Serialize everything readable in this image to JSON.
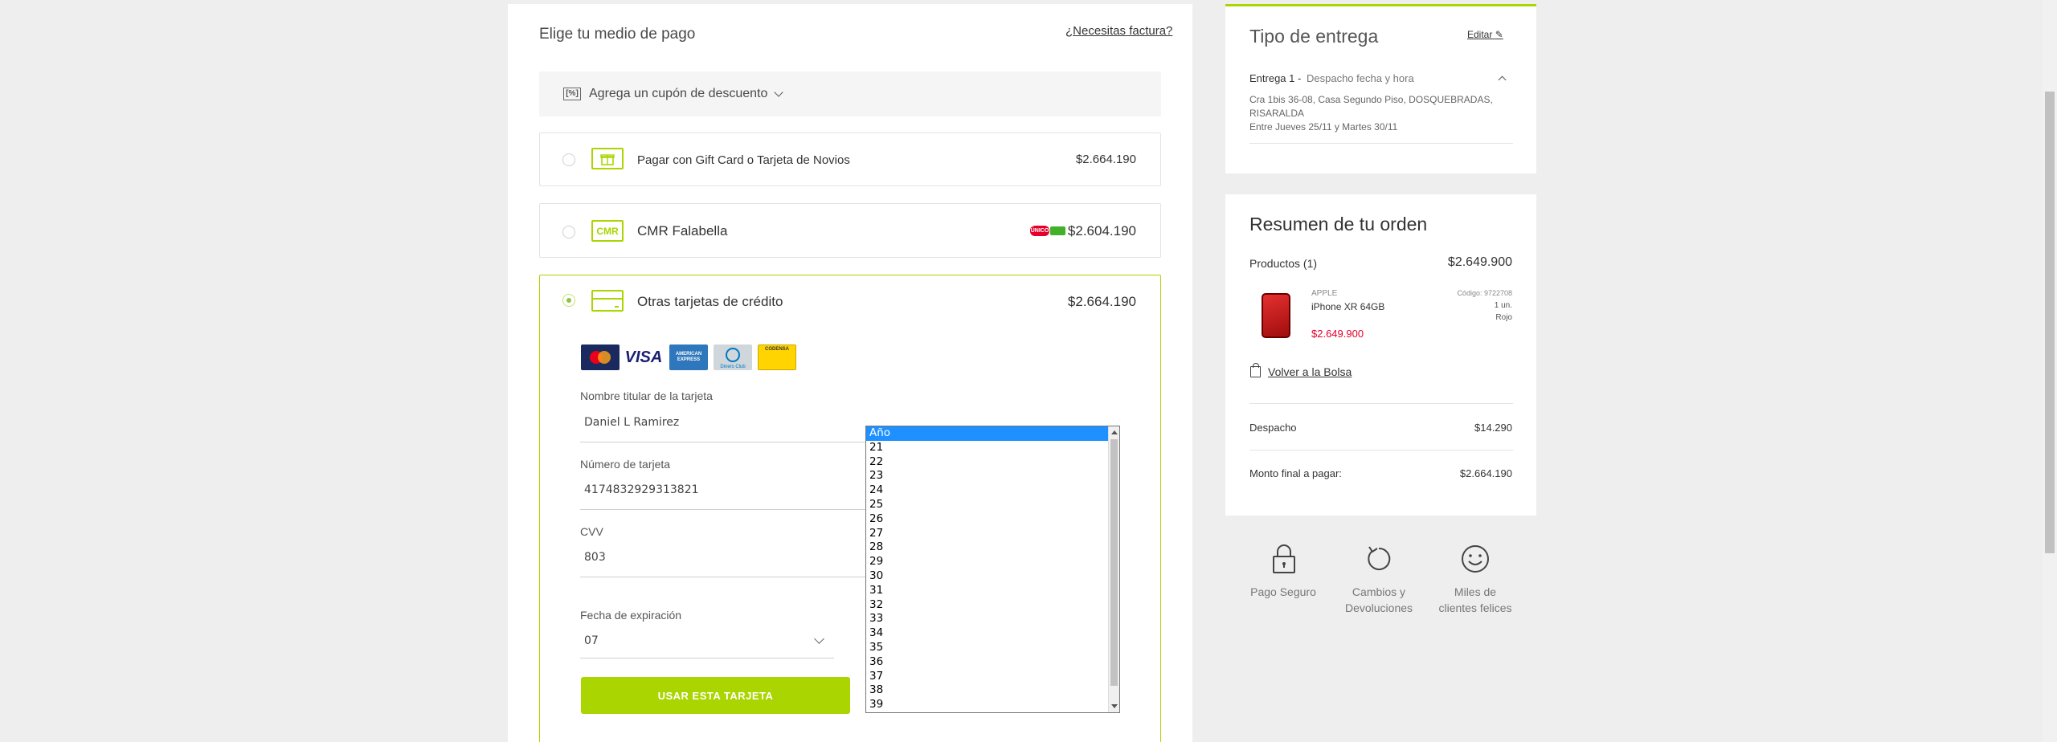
{
  "payment": {
    "title": "Elige tu medio de pago",
    "invoice_link": "¿Necesitas factura?",
    "coupon_label": "Agrega un cupón de descuento",
    "coupon_icon_text": "[%]",
    "options": [
      {
        "label": "Pagar con Gift Card o Tarjeta de Novios",
        "price": "$2.664.190",
        "icon": "gift-card-icon"
      },
      {
        "label": "CMR Falabella",
        "price": "$2.604.190",
        "icon": "cmr-icon",
        "icon_text": "CMR",
        "badge": "ÚNICO"
      },
      {
        "label": "Otras tarjetas de crédito",
        "price": "$2.664.190",
        "icon": "credit-card-icon"
      }
    ],
    "card_brands": [
      "MasterCard",
      "VISA",
      "AMERICAN EXPRESS",
      "Diners Club",
      "CODENSA"
    ],
    "form": {
      "name_label": "Nombre titular de la tarjeta",
      "name_value": "Daniel L Ramirez",
      "number_label": "Número de tarjeta",
      "number_value": "4174832929313821",
      "cvv_label": "CVV",
      "cvv_value": "803",
      "expiry_label": "Fecha de expiración",
      "month_value": "07",
      "submit_label": "USAR ESTA TARJETA"
    },
    "year_dropdown": {
      "selected": "Año",
      "options": [
        "Año",
        "21",
        "22",
        "23",
        "24",
        "25",
        "26",
        "27",
        "28",
        "29",
        "30",
        "31",
        "32",
        "33",
        "34",
        "35",
        "36",
        "37",
        "38",
        "39"
      ]
    }
  },
  "delivery": {
    "title": "Tipo de entrega",
    "edit_label": "Editar",
    "entry_title": "Entrega 1 -",
    "entry_type": "Despacho fecha y hora",
    "address_line1": "Cra 1bis 36-08, Casa Segundo Piso, DOSQUEBRADAS,",
    "address_line2": "RISARALDA",
    "date_range": "Entre Jueves 25/11 y Martes 30/11"
  },
  "summary": {
    "title": "Resumen de tu orden",
    "products_label": "Productos (1)",
    "products_total": "$2.649.900",
    "product": {
      "brand": "APPLE",
      "name": "iPhone XR 64GB",
      "price": "$2.649.900",
      "code": "Código: 9722708",
      "qty": "1 un.",
      "color": "Rojo"
    },
    "back_link": "Volver a la Bolsa",
    "shipping_label": "Despacho",
    "shipping_value": "$14.290",
    "final_label": "Monto final a pagar:",
    "final_value": "$2.664.190"
  },
  "trust": [
    {
      "label1": "Pago Seguro",
      "label2": "",
      "icon": "lock-icon"
    },
    {
      "label1": "Cambios y",
      "label2": "Devoluciones",
      "icon": "return-arrow-icon"
    },
    {
      "label1": "Miles de",
      "label2": "clientes felices",
      "icon": "smiley-icon"
    }
  ],
  "colors": {
    "accent": "#aad500",
    "price_red": "#e4002b",
    "highlight": "#1e90ff"
  }
}
